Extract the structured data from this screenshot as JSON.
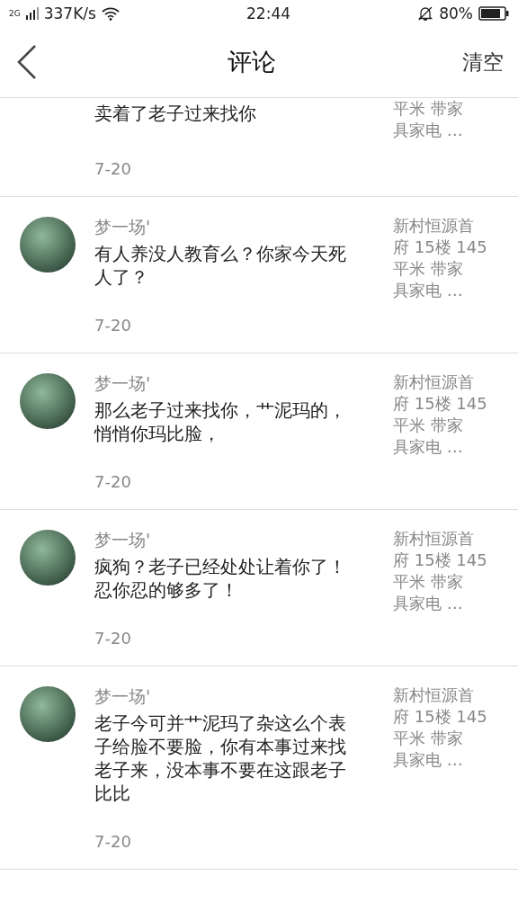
{
  "status_bar": {
    "network": "2G",
    "speed": "337K/s",
    "time": "22:44",
    "battery": "80%"
  },
  "header": {
    "title": "评论",
    "action": "清空"
  },
  "comments": [
    {
      "kind": "partial",
      "text": "卖着了老子过来找你",
      "date": "7-20",
      "side": [
        "平米 带家",
        "具家电 …"
      ]
    },
    {
      "kind": "full",
      "name": "梦一场'",
      "text": "有人养没人教育么？你家今天死人了？",
      "date": "7-20",
      "side": [
        "新村恒源首",
        "府 15楼 145",
        "平米 带家",
        "具家电 …"
      ]
    },
    {
      "kind": "full",
      "name": "梦一场'",
      "text": "那么老子过来找你，艹泥玛的，悄悄你玛比脸，",
      "date": "7-20",
      "side": [
        "新村恒源首",
        "府 15楼 145",
        "平米 带家",
        "具家电 …"
      ]
    },
    {
      "kind": "full",
      "name": "梦一场'",
      "text": "疯狗？老子已经处处让着你了！忍你忍的够多了！",
      "date": "7-20",
      "side": [
        "新村恒源首",
        "府 15楼 145",
        "平米 带家",
        "具家电 …"
      ]
    },
    {
      "kind": "full",
      "name": "梦一场'",
      "text": "老子今可并艹泥玛了杂这么个表子给脸不要脸，你有本事过来找老子来，没本事不要在这跟老子比比",
      "date": "7-20",
      "side": [
        "新村恒源首",
        "府 15楼 145",
        "平米 带家",
        "具家电 …"
      ]
    }
  ]
}
